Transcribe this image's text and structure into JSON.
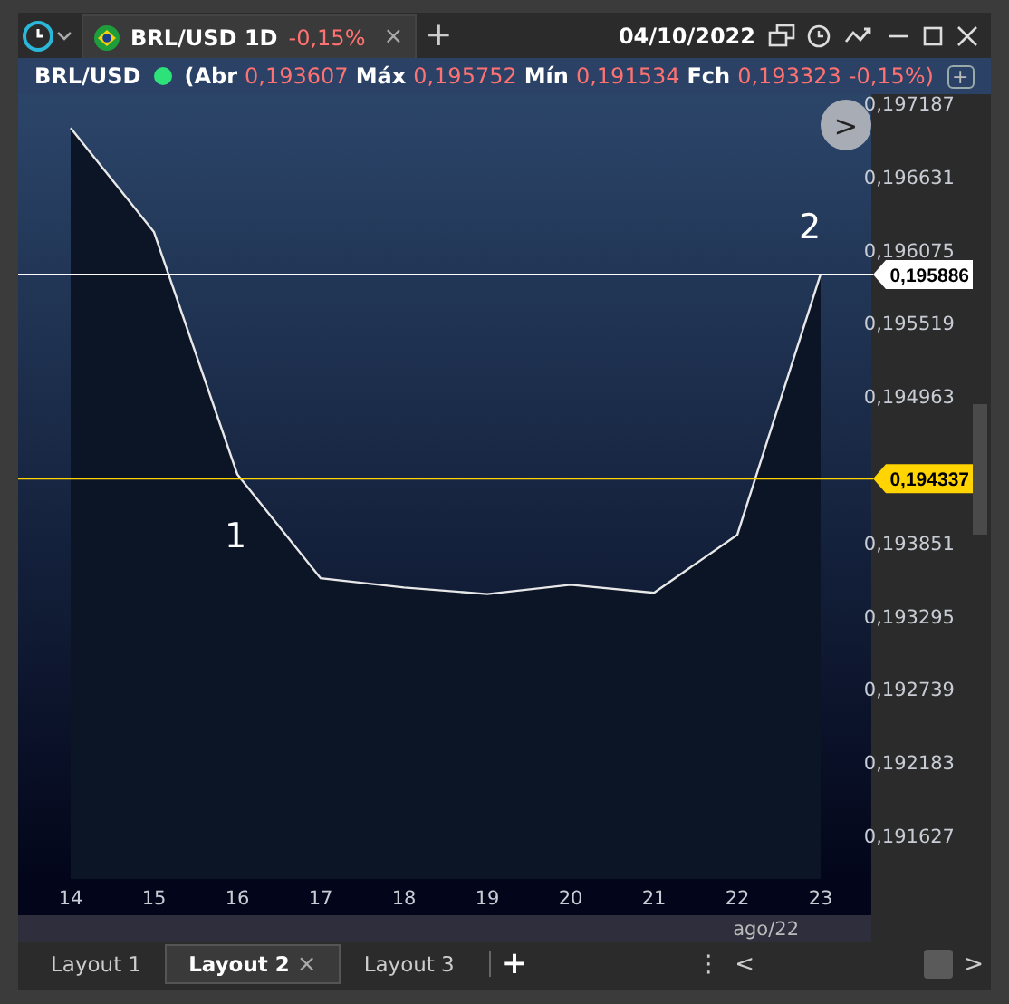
{
  "toolbar": {
    "tab": {
      "label": "BRL/USD 1D",
      "change": "-0,15%",
      "close": "×"
    },
    "add": "+",
    "date": "04/10/2022"
  },
  "legend": {
    "symbol": "BRL/USD",
    "fields": [
      {
        "label": "(Abr",
        "value": "0,193607"
      },
      {
        "label": "Máx",
        "value": "0,195752"
      },
      {
        "label": "Mín",
        "value": "0,191534"
      },
      {
        "label": "Fch",
        "value": "0,193323"
      }
    ],
    "change": "-0,15%)",
    "add": "+"
  },
  "chart": {
    "nav": ">",
    "period": "ago/22",
    "chart_data": {
      "type": "area",
      "categories": [
        "14",
        "15",
        "16",
        "17",
        "18",
        "19",
        "20",
        "21",
        "22",
        "23"
      ],
      "series": [
        {
          "color": "#0c1526",
          "values": [
            0.197,
            0.19621,
            0.19437,
            0.19358,
            0.19351,
            0.19346,
            0.19353,
            0.19347,
            0.19391,
            0.19589
          ]
        }
      ],
      "ylim": [
        0.191297,
        0.197256
      ],
      "ref_lines": [
        {
          "axis": "y",
          "value": 0.195886,
          "label": "0,195886",
          "color": "#ffffff"
        },
        {
          "axis": "y",
          "value": 0.194337,
          "label": "0,194337",
          "color": "#ffd400"
        }
      ],
      "annotations": [
        "2",
        "1"
      ],
      "yticks": [
        {
          "value": 0.197187,
          "label": "0,197187"
        },
        {
          "value": 0.196631,
          "label": "0,196631"
        },
        {
          "value": 0.196075,
          "label": "0,196075"
        },
        {
          "value": 0.195519,
          "label": "0,195519"
        },
        {
          "value": 0.194963,
          "label": "0,194963"
        },
        {
          "value": 0.193851,
          "label": "0,193851"
        },
        {
          "value": 0.193295,
          "label": "0,193295"
        },
        {
          "value": 0.192739,
          "label": "0,192739"
        },
        {
          "value": 0.192183,
          "label": "0,192183"
        },
        {
          "value": 0.191627,
          "label": "0,191627"
        }
      ]
    }
  },
  "layout_tabs": [
    {
      "label": "Layout 1",
      "selected": false
    },
    {
      "label": "Layout 2",
      "selected": true,
      "close": "×"
    },
    {
      "label": "Layout 3",
      "selected": false
    }
  ],
  "layout_controls": {
    "add": "+",
    "more": "⋮",
    "prev": "<",
    "next": ">"
  }
}
